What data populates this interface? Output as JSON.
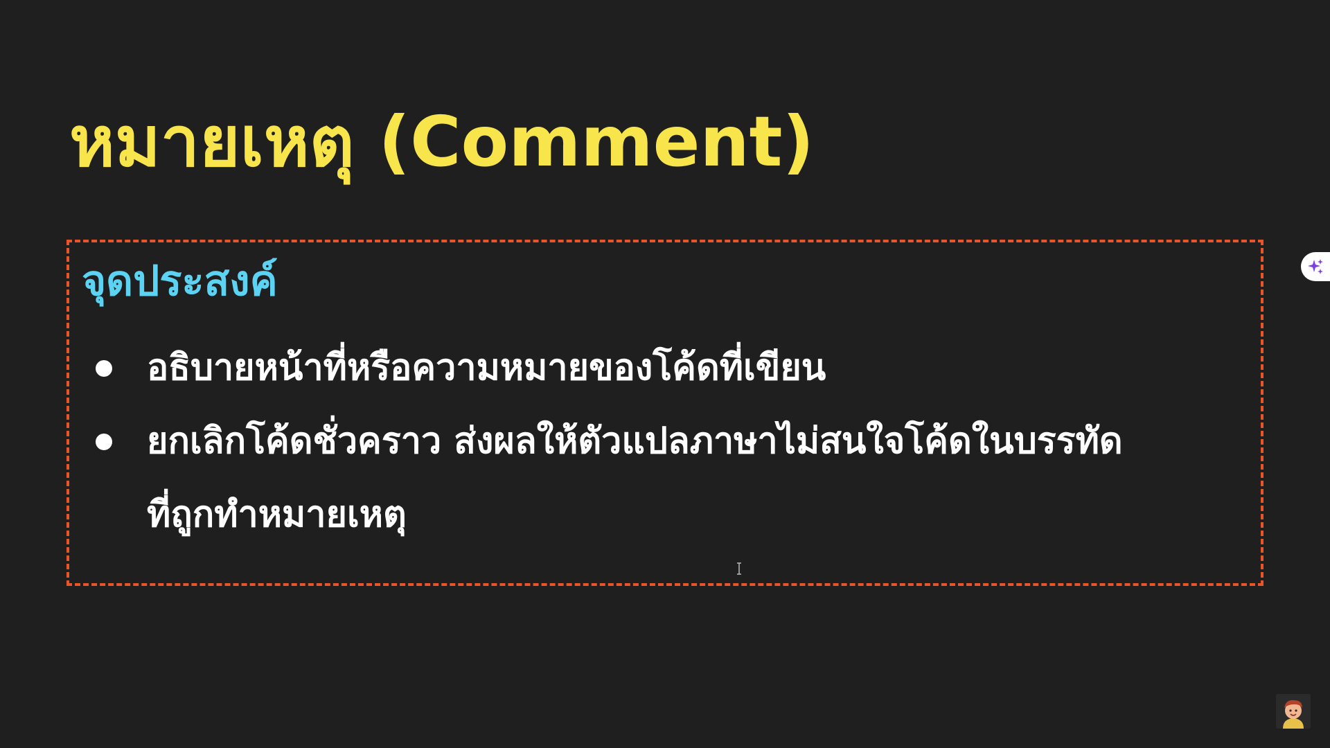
{
  "slide": {
    "title": "หมายเหตุ (Comment)",
    "box": {
      "heading": "จุดประสงค์",
      "bullets": [
        {
          "lines": [
            "อธิบายหน้าที่หรือความหมายของโค้ดที่เขียน"
          ]
        },
        {
          "lines": [
            "ยกเลิกโค้ดชั่วคราว ส่งผลให้ตัวแปลภาษาไม่สนใจโค้ดในบรรทัด",
            "ที่ถูกทำหมายเหตุ"
          ]
        }
      ]
    }
  },
  "colors": {
    "background": "#1f1f1f",
    "title": "#f8e54b",
    "heading": "#5dd3f3",
    "body_text": "#ffffff",
    "box_border": "#e9542a",
    "ai_icon": "#7b3fe4"
  },
  "icons": {
    "ai_button": "sparkle-icon",
    "avatar": "cartoon-avatar",
    "cursor": "text-cursor-icon"
  }
}
